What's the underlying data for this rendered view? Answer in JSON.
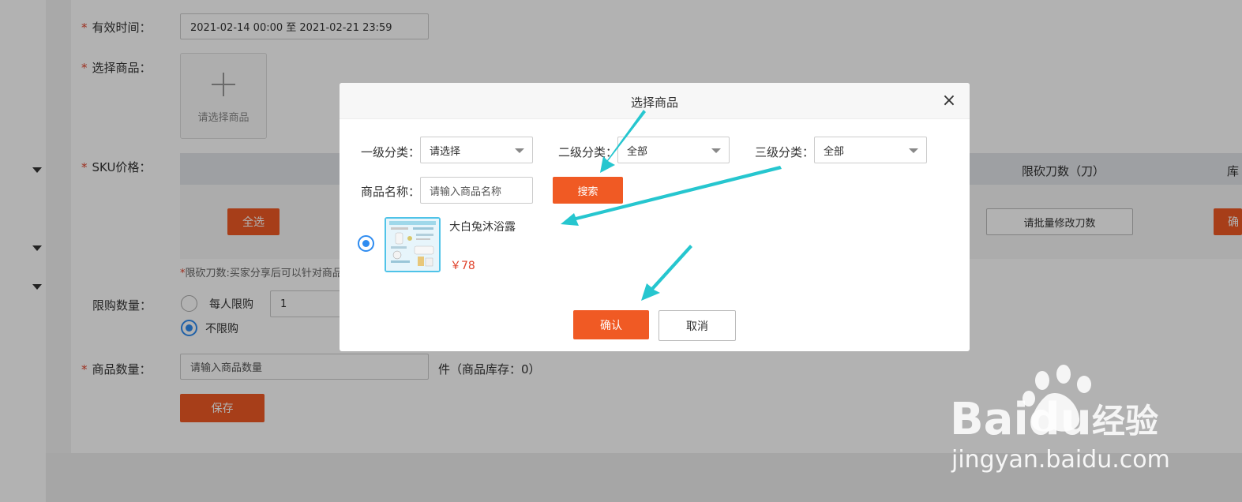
{
  "colors": {
    "accent": "#f05a24",
    "required": "#e0422b",
    "radio_active": "#2f8cf0",
    "arrow": "#26c6cf",
    "price": "#e0422b"
  },
  "form": {
    "valid_time": {
      "label": "有效时间：",
      "value": "2021-02-14 00:00 至 2021-02-21 23:59"
    },
    "select_product": {
      "label": "选择商品：",
      "upload_text": "请选择商品"
    },
    "sku_price": {
      "label": "SKU价格：",
      "select_all": "全选",
      "col_limit": "限砍刀数（刀）",
      "col_stock": "库",
      "batch_button": "请批量修改刀数",
      "confirm_partial": "确"
    },
    "hint": "限砍刀数:买家分享后可以针对商品",
    "limit_qty": {
      "label": "限购数量：",
      "option_per_person": "每人限购",
      "per_person_value": "1",
      "option_unlimited": "不限购"
    },
    "product_qty": {
      "label": "商品数量：",
      "placeholder": "请输入商品数量",
      "suffix": "件（商品库存：0）"
    },
    "save_button": "保存"
  },
  "modal": {
    "title": "选择商品",
    "close_icon": "close-icon",
    "level1": {
      "label": "一级分类：",
      "value": "请选择"
    },
    "level2": {
      "label": "二级分类：",
      "value": "全部"
    },
    "level3": {
      "label": "三级分类：",
      "value": "全部"
    },
    "name": {
      "label": "商品名称：",
      "placeholder": "请输入商品名称"
    },
    "search_button": "搜索",
    "product": {
      "name": "大白兔沐浴露",
      "price": "￥78",
      "selected": true
    },
    "confirm_button": "确认",
    "cancel_button": "取消"
  },
  "watermark": {
    "brand": "Baidu",
    "cn": "经验",
    "url": "jingyan.baidu.com"
  }
}
